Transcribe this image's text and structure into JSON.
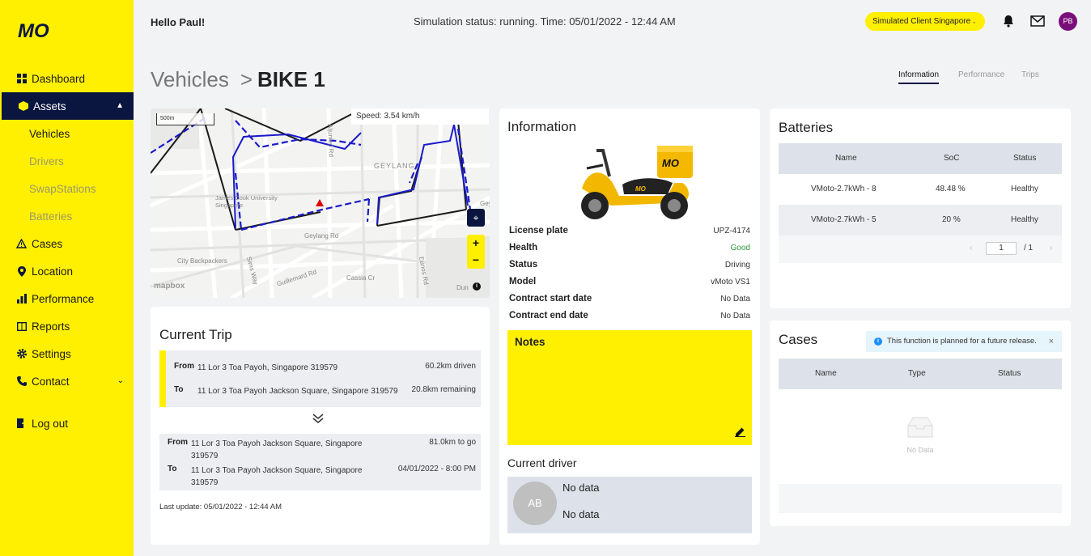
{
  "app": {
    "logo_text": "MO"
  },
  "sidebar": {
    "items": [
      {
        "label": "Dashboard",
        "icon": "dashboard-icon"
      },
      {
        "label": "Assets",
        "icon": "box-icon",
        "active": true
      },
      {
        "label": "Vehicles",
        "sub": true
      },
      {
        "label": "Drivers",
        "sub": true,
        "dim": true
      },
      {
        "label": "SwapStations",
        "sub": true,
        "dim": true
      },
      {
        "label": "Batteries",
        "sub": true,
        "dim": true
      },
      {
        "label": "Cases",
        "icon": "warning-icon"
      },
      {
        "label": "Location",
        "icon": "location-pin-icon"
      },
      {
        "label": "Performance",
        "icon": "bar-chart-icon"
      },
      {
        "label": "Reports",
        "icon": "book-icon"
      },
      {
        "label": "Settings",
        "icon": "gear-icon"
      },
      {
        "label": "Contact",
        "icon": "phone-icon"
      }
    ],
    "logout_label": "Log out"
  },
  "header": {
    "greeting": "Hello Paul!",
    "simulation_status": "Simulation status: running. Time: 05/01/2022 - 12:44 AM",
    "client_selector": "Simulated Client Singapore",
    "avatar_initials": "PB"
  },
  "breadcrumb": {
    "parent": "Vehicles",
    "separator": ">",
    "current": "BIKE 1"
  },
  "tabs": [
    {
      "label": "Information",
      "active": true
    },
    {
      "label": "Performance"
    },
    {
      "label": "Trips"
    }
  ],
  "map": {
    "speed": "Speed: 3.54 km/h",
    "scale": "500m",
    "attribution": "mapbox",
    "labels": [
      "GEYLANG",
      "James Cook University Singapore",
      "Geylang Rd",
      "City Backpackers",
      "Sims Way",
      "Guillemard Rd",
      "Cassia Cr",
      "Aljunied Rd",
      "Eunos Rd",
      "Dun",
      "Gey"
    ]
  },
  "current_trip": {
    "title": "Current Trip",
    "legs": [
      {
        "from_label": "From",
        "from": "11 Lor 3 Toa Payoh, Singapore 319579",
        "from_info": "60.2km driven",
        "to_label": "To",
        "to": "11 Lor 3 Toa Payoh Jackson Square, Singapore 319579",
        "to_info": "20.8km remaining"
      },
      {
        "from_label": "From",
        "from": "11 Lor 3 Toa Payoh Jackson Square, Singapore 319579",
        "from_info": "81.0km to go",
        "to_label": "To",
        "to": "11 Lor 3 Toa Payoh Jackson Square, Singapore 319579",
        "to_info": "04/01/2022 - 8:00 PM"
      }
    ],
    "last_update": "Last update: 05/01/2022 - 12:44 AM"
  },
  "information": {
    "title": "Information",
    "rows": [
      {
        "key": "License plate",
        "value": "UPZ-4174"
      },
      {
        "key": "Health",
        "value": "Good",
        "status_color": "#2e9a3b"
      },
      {
        "key": "Status",
        "value": "Driving"
      },
      {
        "key": "Model",
        "value": "vMoto VS1"
      },
      {
        "key": "Contract start date",
        "value": "No Data"
      },
      {
        "key": "Contract end date",
        "value": "No Data"
      }
    ],
    "scooter_box_text": "MO",
    "notes_title": "Notes",
    "driver_title": "Current driver",
    "driver_initials": "AB",
    "driver_line1": "No data",
    "driver_line2": "No data"
  },
  "batteries": {
    "title": "Batteries",
    "columns": [
      "Name",
      "SoC",
      "Status"
    ],
    "rows": [
      {
        "name": "VMoto-2.7kWh - 8",
        "soc": "48.48 %",
        "status": "Healthy"
      },
      {
        "name": "VMoto-2.7kWh - 5",
        "soc": "20 %",
        "status": "Healthy"
      }
    ],
    "pager": {
      "page": "1",
      "of": "/ 1"
    }
  },
  "cases": {
    "title": "Cases",
    "notice": "This function is planned for a future release.",
    "columns": [
      "Name",
      "Type",
      "Status"
    ],
    "empty": "No Data"
  },
  "colors": {
    "brand_yellow": "#ffef00",
    "navy": "#0b1640",
    "avatar": "#7b0f7a",
    "good": "#2e9a3b",
    "route": "#1a1ac8"
  }
}
